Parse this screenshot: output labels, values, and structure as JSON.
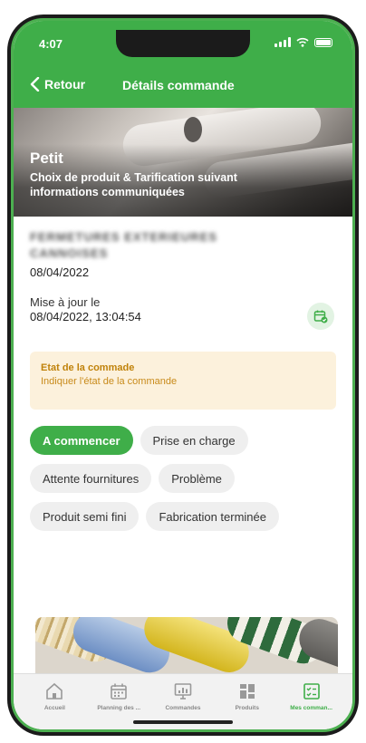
{
  "status_bar": {
    "time": "4:07"
  },
  "nav": {
    "back_label": "Retour",
    "title": "Détails commande"
  },
  "hero": {
    "title": "Petit",
    "description": "Choix de produit & Tarification suivant informations communiquées"
  },
  "order": {
    "client_name": "FERMETURES EXTERIEURES CANNOISES",
    "date": "08/04/2022",
    "update_label": "Mise à jour le",
    "update_value": "08/04/2022, 13:04:54"
  },
  "state_box": {
    "title": "Etat de la commade",
    "hint": "Indiquer l'état de la commande"
  },
  "status_chips": [
    {
      "label": "A commencer",
      "active": true
    },
    {
      "label": "Prise en charge",
      "active": false
    },
    {
      "label": "Attente fournitures",
      "active": false
    },
    {
      "label": "Problème",
      "active": false
    },
    {
      "label": "Produit semi fini",
      "active": false
    },
    {
      "label": "Fabrication terminée",
      "active": false
    }
  ],
  "tabbar": {
    "items": [
      {
        "label": "Accueil",
        "icon": "home-icon",
        "active": false
      },
      {
        "label": "Planning des ...",
        "icon": "calendar-icon",
        "active": false
      },
      {
        "label": "Commandes",
        "icon": "monitor-chart-icon",
        "active": false
      },
      {
        "label": "Produits",
        "icon": "grid-icon",
        "active": false
      },
      {
        "label": "Mes comman...",
        "icon": "checklist-icon",
        "active": true
      }
    ]
  },
  "colors": {
    "accent": "#3fae49",
    "warning_bg": "#fcf1dc",
    "warning_text": "#c0820a"
  }
}
